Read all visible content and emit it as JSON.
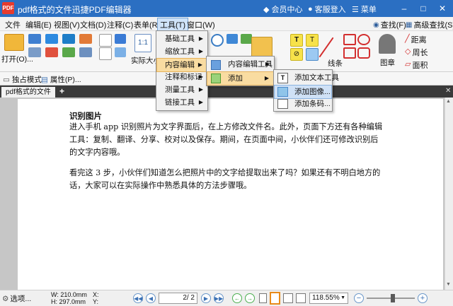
{
  "window": {
    "app_icon_text": "PDF",
    "title": "pdf格式的文件迅捷PDF编辑器",
    "member_center": "会员中心",
    "login": "客服登入",
    "menu_label": "菜单",
    "min_symbol": "–",
    "max_symbol": "□",
    "close_symbol": "✕"
  },
  "menubar": {
    "items": [
      "文件",
      "编辑(E)",
      "视图(V)",
      "文档(D)",
      "注释(C)",
      "表单(R)",
      "工具(T)",
      "窗口(W)"
    ],
    "active_index": 6,
    "right_find": "查找(F)",
    "right_adv_find": "高级查找(S)"
  },
  "ribbon": {
    "open_label": "打开(O)...",
    "zoom_label": "实际大小",
    "line_label": "线条",
    "stamp_label": "图章",
    "distance_label": "距离",
    "perimeter_label": "周长",
    "area_label": "面积"
  },
  "toolbar2": {
    "exclusive_mode": "独占模式",
    "properties": "属性(P)..."
  },
  "tabs": {
    "doc_tab": "pdf格式的文件",
    "close_symbol": "✕",
    "add_symbol": "+"
  },
  "tools_menu": {
    "items": [
      "基础工具",
      "缩放工具",
      "内容编辑",
      "注释和标记",
      "测量工具",
      "链接工具"
    ],
    "highlighted_index": 2
  },
  "content_edit_menu": {
    "items": [
      "内容编辑工具",
      "添加"
    ],
    "highlighted_index": 1
  },
  "add_menu": {
    "items": [
      "添加文本工具",
      "添加图像...",
      "添加条码..."
    ],
    "highlighted_index": 1
  },
  "document": {
    "heading": "识别图片",
    "paragraph1": "进入手机 app 识别照片为文字界面后，在上方修改文件名。此外，页面下方还有各种编辑工具：复制、翻译、分享、校对以及保存。期间，在页面中间，小伙伴们还可修改识别后的文字内容哦。",
    "paragraph2": "看完这 3 步，小伙伴们知道怎么把照片中的文字给提取出来了吗？如果还有不明白地方的话，大家可以在实际操作中熟悉具体的方法步骤哦。"
  },
  "statusbar": {
    "options": "选项...",
    "width": "W: 210.0mm",
    "height": "H: 297.0mm",
    "x": "X:",
    "y": "Y:",
    "page_input": "2",
    "page_total": "/ 2",
    "zoom": "118.55%",
    "zoom_out": "−",
    "zoom_in": "+",
    "zoom_level": 0.55
  },
  "colors": {
    "title_bar": "#2b6fc2",
    "menu_highlight": "#f9dca1",
    "accent_blue": "#3d72b5"
  }
}
